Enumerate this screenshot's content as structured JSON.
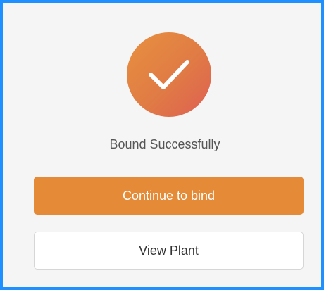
{
  "status": {
    "icon": "check-circle-icon",
    "message": "Bound Successfully"
  },
  "actions": {
    "continue_label": "Continue to bind",
    "view_plant_label": "View Plant"
  },
  "colors": {
    "frame_border": "#1e90ff",
    "primary_button": "#e58b38",
    "icon_gradient_start": "#e8913f",
    "icon_gradient_end": "#de5f52"
  }
}
